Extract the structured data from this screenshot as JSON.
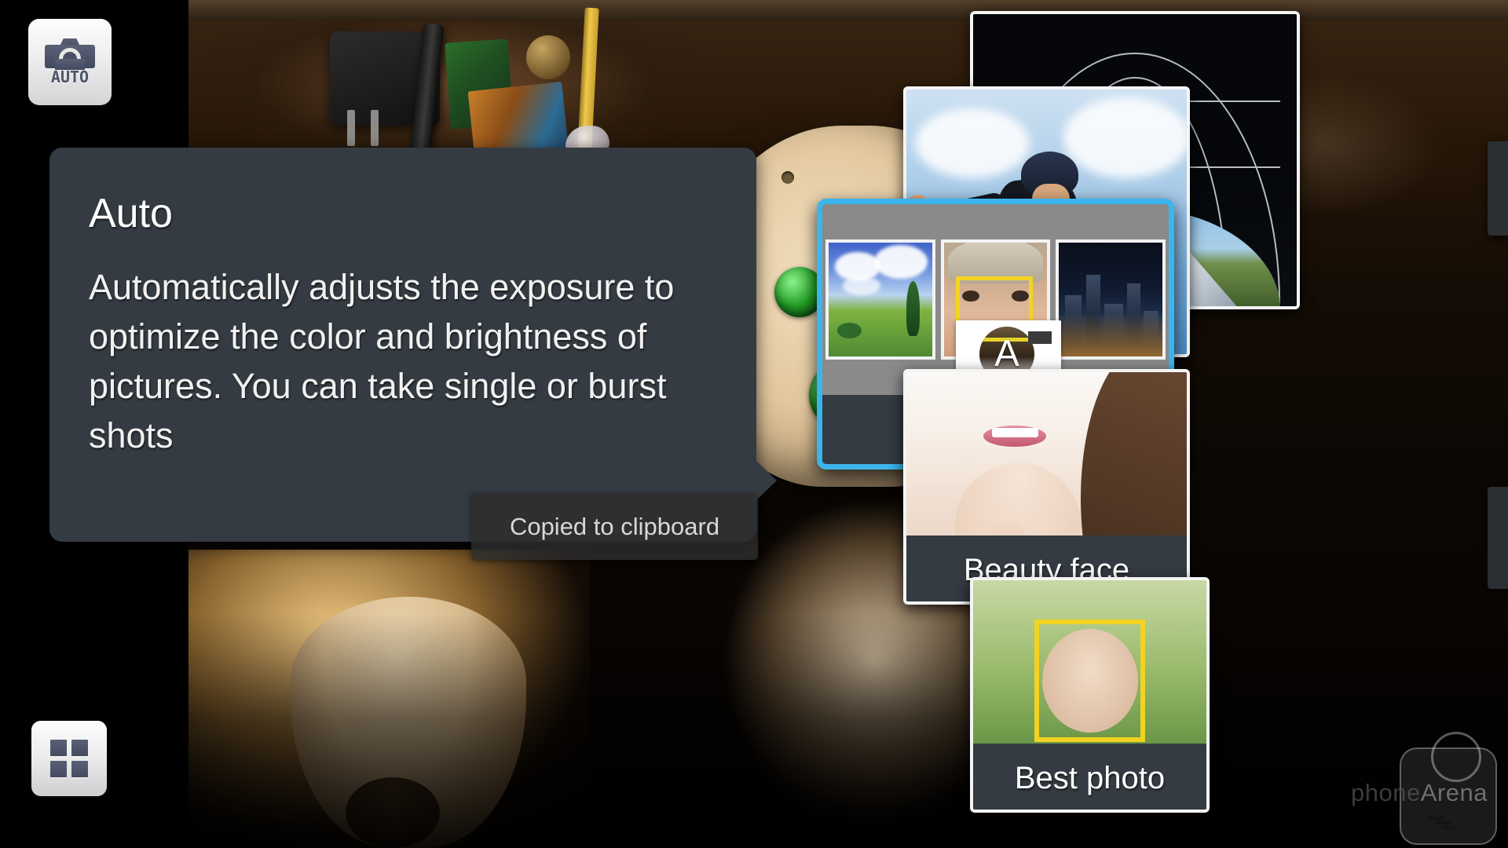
{
  "app": {
    "name": "Camera",
    "screen": "shooting-mode-selector"
  },
  "mode_badge": {
    "icon": "camera-auto-icon",
    "label": "AUTO"
  },
  "grid_button": {
    "icon": "grid-modes-icon",
    "label": ""
  },
  "tooltip": {
    "title": "Auto",
    "description": "Automatically adjusts the exposure to optimize the color and brightness of pictures. You can take single or burst shots",
    "background_color": "#343b42",
    "text_color": "#ffffff"
  },
  "toast": {
    "message": "Copied to clipboard",
    "background_color": "#2d2d2d",
    "text_color": "#d8d8d8"
  },
  "carousel": {
    "selected_index": 2,
    "selection_color": "#3cb4ec",
    "label_background": "#343b42",
    "tiles": [
      {
        "id": "panorama",
        "label": "",
        "icon": "panorama-dome-icon",
        "selected": false
      },
      {
        "id": "skater",
        "label": "",
        "icon": "action-shot-icon",
        "selected": false
      },
      {
        "id": "auto",
        "label": "Auto",
        "icon": "camera-auto-icon",
        "selected": true
      },
      {
        "id": "beauty-face",
        "label": "Beauty face",
        "icon": "beauty-face-icon",
        "selected": false
      },
      {
        "id": "best-photo",
        "label": "Best photo",
        "icon": "best-photo-icon",
        "selected": false
      }
    ]
  },
  "watermark": {
    "part1": "phone",
    "part2": "Arena"
  }
}
